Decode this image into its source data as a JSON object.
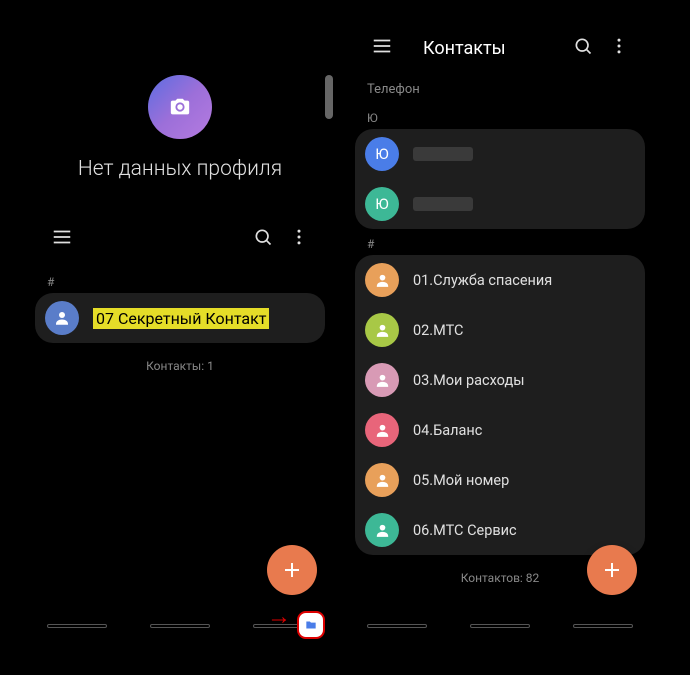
{
  "left": {
    "profile_title": "Нет данных профиля",
    "index_symbol": "#",
    "contact": {
      "name": "07 Секретный Контакт",
      "avatar_color": "#5a7dc9"
    },
    "footer": "Контакты: 1"
  },
  "right": {
    "toolbar_title": "Контакты",
    "section_phone": "Телефон",
    "index_letter": "Ю",
    "contacts_u": [
      {
        "letter": "Ю",
        "color": "#4a7de8"
      },
      {
        "letter": "Ю",
        "color": "#3db896"
      }
    ],
    "index_symbol": "#",
    "contacts_num": [
      {
        "name": "01.Служба спасения",
        "color": "#e8a05a"
      },
      {
        "name": "02.МТС",
        "color": "#a8c846"
      },
      {
        "name": "03.Мои расходы",
        "color": "#d89ab5"
      },
      {
        "name": "04.Баланс",
        "color": "#e8657a"
      },
      {
        "name": "05.Мой номер",
        "color": "#e8a05a"
      },
      {
        "name": "06.МТС Сервис",
        "color": "#3db896"
      }
    ],
    "footer": "Контактов: 82"
  }
}
